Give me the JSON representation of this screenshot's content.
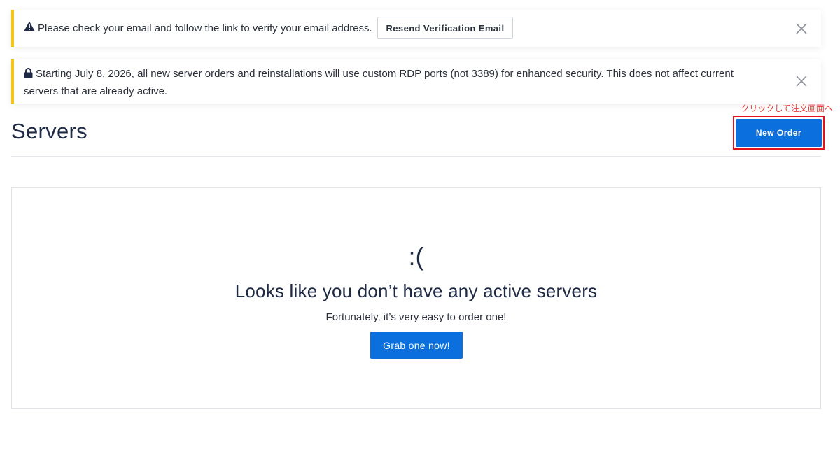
{
  "alerts": {
    "verify": {
      "icon": "warning-triangle-icon",
      "text": "Please check your email and follow the link to verify your email address.",
      "button_label": "Resend Verification Email",
      "close_icon": "close-icon"
    },
    "rdp_notice": {
      "icon": "lock-icon",
      "text": "Starting July 8, 2026, all new server orders and reinstallations will use custom RDP ports (not 3389) for enhanced security. This does not affect current servers that are already active.",
      "close_icon": "close-icon"
    },
    "accent_color": "#f5c518"
  },
  "header": {
    "title": "Servers",
    "new_order_label": "New Order",
    "annotation": "クリックして注文画面へ",
    "annotation_color": "#e53935"
  },
  "empty_state": {
    "face": ":(",
    "heading": "Looks like you don’t have any active servers",
    "subtext": "Fortunately, it’s very easy to order one!",
    "cta_label": "Grab one now!"
  },
  "colors": {
    "primary": "#0b6fdd",
    "text": "#1f2a44",
    "highlight_border": "#e0151c"
  }
}
